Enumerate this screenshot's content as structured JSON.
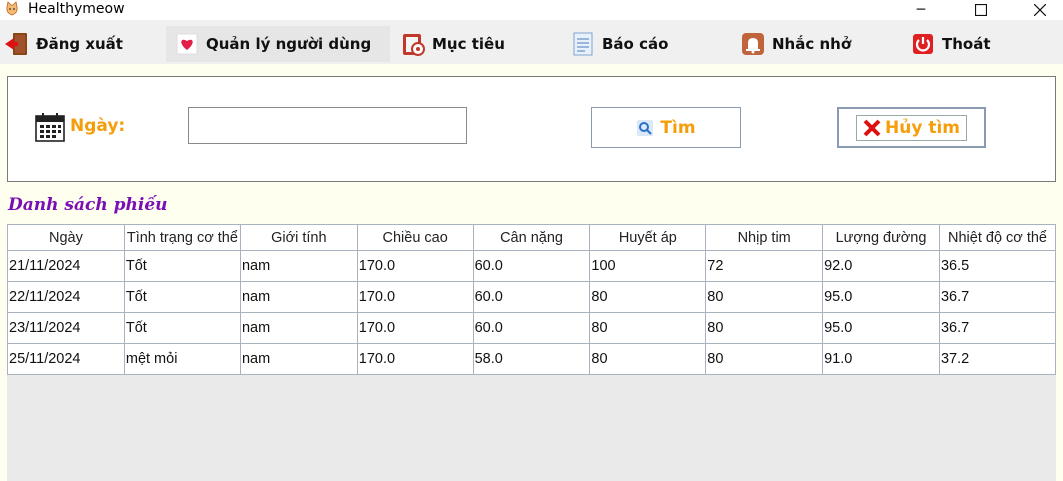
{
  "window": {
    "title": "Healthymeow",
    "controls": [
      "minimize-icon",
      "maximize-icon",
      "close-icon"
    ]
  },
  "menu": [
    {
      "label": "Đăng xuất",
      "icon": "logout-icon"
    },
    {
      "label": "Quản lý người dùng",
      "icon": "heart-icon",
      "active": true
    },
    {
      "label": "Mục tiêu",
      "icon": "target-icon"
    },
    {
      "label": "Báo cáo",
      "icon": "report-icon"
    },
    {
      "label": "Nhắc nhở",
      "icon": "bell-icon"
    },
    {
      "label": "Thoát",
      "icon": "power-icon"
    }
  ],
  "search": {
    "date_label": "Ngày:",
    "date_value": "",
    "find_label": "Tìm",
    "cancel_label": "Hủy tìm"
  },
  "list_title": "Danh sách phiếu",
  "table": {
    "columns": [
      "Ngày",
      "Tình trạng cơ thể",
      "Giới tính",
      "Chiều cao",
      "Cân nặng",
      "Huyết áp",
      "Nhịp tim",
      "Lượng đường",
      "Nhiệt độ cơ thể"
    ],
    "rows": [
      [
        "21/11/2024",
        "Tốt",
        "nam",
        "170.0",
        "60.0",
        "100",
        "72",
        "92.0",
        "36.5"
      ],
      [
        "22/11/2024",
        "Tốt",
        "nam",
        "170.0",
        "60.0",
        "80",
        "80",
        "95.0",
        "36.7"
      ],
      [
        "23/11/2024",
        "Tốt",
        "nam",
        "170.0",
        "60.0",
        "80",
        "80",
        "95.0",
        "36.7"
      ],
      [
        "25/11/2024",
        "mệt mỏi",
        "nam",
        "170.0",
        "58.0",
        "80",
        "80",
        "91.0",
        "37.2"
      ]
    ]
  },
  "colors": {
    "accent": "#f59e0b",
    "title": "#7b0fb6",
    "panel_bg": "#fffff0"
  }
}
